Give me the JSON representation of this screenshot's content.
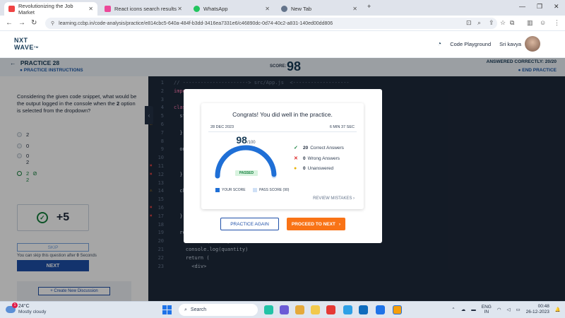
{
  "browser": {
    "tabs": [
      {
        "label": "Revolutionizing the Job Market",
        "favicon_color": "#ef4444"
      },
      {
        "label": "React icons search results",
        "favicon_color": "#ec4899"
      },
      {
        "label": "WhatsApp",
        "favicon_color": "#22c55e"
      },
      {
        "label": "New Tab",
        "favicon_color": "#64748b"
      }
    ],
    "url": "learning.ccbp.in/code-analysis/practice/e814cbc5-640a-484f-b3dd-3416ea7331e6/c46890dc-0d74-40c2-a831-140ed00dd806"
  },
  "header": {
    "logo_line1": "NXT",
    "logo_line2": "WAVE",
    "logo_tm": "TM",
    "code_playground": "Code Playground",
    "user_name": "Sri kavya"
  },
  "practice_bar": {
    "title": "PRACTICE 28",
    "instructions": "PRACTICE INSTRUCTIONS",
    "score_label": "SCORE:",
    "score_value": "98",
    "answered": "ANSWERED CORRECTLY: 20/20",
    "end_practice": "END PRACTICE"
  },
  "question": {
    "text_before": "Considering the given code snippet, what would be the output logged in the console when the ",
    "text_bold": "2",
    "text_after": " option is selected from the dropdown?",
    "options": [
      {
        "line1": "2",
        "line2": ""
      },
      {
        "line1": "0",
        "line2": ""
      },
      {
        "line1": "0",
        "line2": "2"
      },
      {
        "line1": "2",
        "line2": "2"
      }
    ],
    "points": "+5",
    "skip_label": "SKIP",
    "skip_note_prefix": "You can skip this question after ",
    "skip_seconds": "0",
    "skip_note_suffix": " Seconds",
    "next_label": "NEXT",
    "discussion_label": "+ Create New Discussion"
  },
  "editor": {
    "lines": [
      {
        "n": "1",
        "mark": "",
        "code": "// ----------------------> src/App.js  <-------------------"
      },
      {
        "n": "2",
        "mark": "",
        "code": "import"
      },
      {
        "n": "3",
        "mark": "",
        "code": ""
      },
      {
        "n": "4",
        "mark": "",
        "code": "class"
      },
      {
        "n": "5",
        "mark": "warn",
        "code": "  stat"
      },
      {
        "n": "6",
        "mark": "warn",
        "code": "    qu"
      },
      {
        "n": "7",
        "mark": "",
        "code": "  }"
      },
      {
        "n": "8",
        "mark": "",
        "code": ""
      },
      {
        "n": "9",
        "mark": "",
        "code": "  onCh"
      },
      {
        "n": "10",
        "mark": "",
        "code": "    co"
      },
      {
        "n": "11",
        "mark": "err",
        "code": "    th"
      },
      {
        "n": "12",
        "mark": "err",
        "code": "  }"
      },
      {
        "n": "13",
        "mark": "",
        "code": ""
      },
      {
        "n": "14",
        "mark": "warn",
        "code": "  chan"
      },
      {
        "n": "15",
        "mark": "",
        "code": "    co"
      },
      {
        "n": "16",
        "mark": "err",
        "code": "    co"
      },
      {
        "n": "17",
        "mark": "err",
        "code": "  }"
      },
      {
        "n": "18",
        "mark": "",
        "code": ""
      },
      {
        "n": "19",
        "mark": "",
        "code": "  render() {"
      },
      {
        "n": "20",
        "mark": "",
        "code": "    const {quantity} = this.state"
      },
      {
        "n": "21",
        "mark": "",
        "code": "    console.log(quantity)"
      },
      {
        "n": "22",
        "mark": "",
        "code": "    return ("
      },
      {
        "n": "23",
        "mark": "",
        "code": "      <div>"
      }
    ]
  },
  "modal": {
    "congrats": "Congrats! You did well in the practice.",
    "date": "28 DEC 2023",
    "duration": "6 MIN 37 SEC",
    "score": "98",
    "score_total": "/100",
    "score_fraction": 0.98,
    "pass_score_fraction": 0.9,
    "status": "PASSED",
    "correct_count": "20",
    "correct_label": "Correct Answers",
    "wrong_count": "0",
    "wrong_label": "Wrong Answers",
    "unanswered_count": "0",
    "unanswered_label": "Unanswered",
    "legend_your_score": "YOUR SCORE",
    "legend_pass_score": "PASS SCORE (90)",
    "review_mistakes": "REVIEW MISTAKES",
    "practice_again": "PRACTICE AGAIN",
    "proceed": "PROCEED TO NEXT"
  },
  "taskbar": {
    "temperature": "24°C",
    "weather": "Mostly cloudy",
    "search_placeholder": "Search",
    "lang1": "ENG",
    "lang2": "IN",
    "time": "00:48",
    "date": "26-12-2023",
    "notification_count": "1"
  },
  "colors": {
    "primary": "#1e4fa8",
    "accent": "#f97316",
    "success": "#15803d",
    "editor_bg": "#1e2a3b"
  }
}
